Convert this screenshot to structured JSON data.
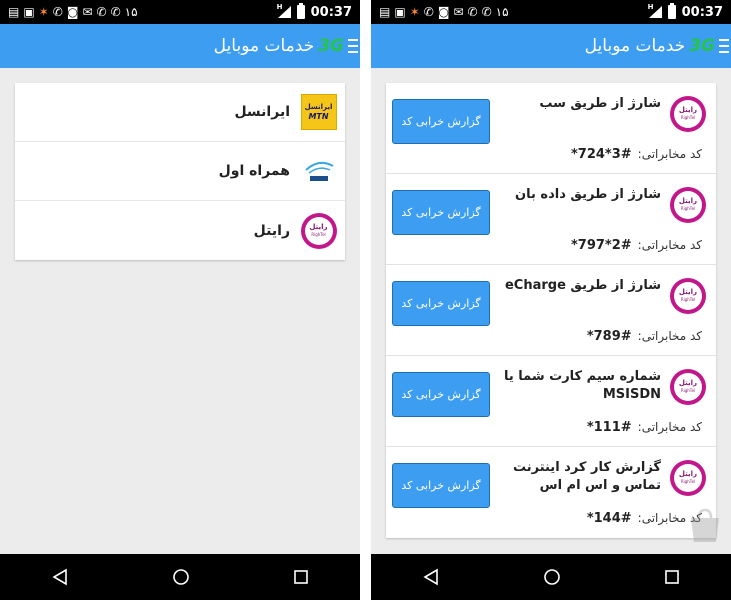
{
  "status_bar": {
    "time": "00:37",
    "notif_count": "۱۵",
    "signal_type": "H"
  },
  "app": {
    "title": "خدمات موبایل",
    "logo_text": "3G"
  },
  "operators": [
    {
      "name": "ایرانسل",
      "logo": "irancell-logo"
    },
    {
      "name": "همراه اول",
      "logo": "mci-logo"
    },
    {
      "name": "رایتل",
      "logo": "rightel-logo"
    }
  ],
  "logos": {
    "irancell_fa": "ایرانسل",
    "irancell_en": "MTN",
    "rightel_fa": "رایتل",
    "rightel_en": "RighTel"
  },
  "services": [
    {
      "title": "شارژ از طریق سب",
      "code_label": "کد مخابراتی:",
      "code": "*724*3#",
      "button": "گزارش خرابی کد"
    },
    {
      "title": "شارژ از طریق داده بان",
      "code_label": "کد مخابراتی:",
      "code": "*797*2#",
      "button": "گزارش خرابی کد"
    },
    {
      "title": "شارژ از طریق eCharge",
      "code_label": "کد مخابراتی:",
      "code": "*789#",
      "button": "گزارش خرابی کد"
    },
    {
      "title": "شماره سیم کارت شما یا MSISDN",
      "code_label": "کد مخابراتی:",
      "code": "*111#",
      "button": "گزارش خرابی کد"
    },
    {
      "title": "گزارش کار کرد اینترنت تماس و اس ام اس",
      "code_label": "کد مخابراتی:",
      "code": "*144#",
      "button": "گزارش خرابی کد"
    }
  ],
  "colors": {
    "app_bar": "#3d9df0",
    "button": "#3d9df0",
    "rightel": "#c2178b",
    "irancell": "#f5c518"
  }
}
